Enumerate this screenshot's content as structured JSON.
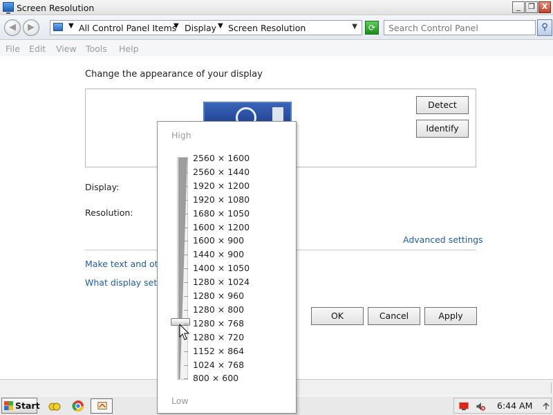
{
  "window": {
    "title": "Screen Resolution",
    "minimize": "_",
    "restore": "❐",
    "close": "X"
  },
  "navigation": {
    "back": "◀",
    "forward": "▶",
    "breadcrumbs": [
      "All Control Panel Items",
      "Display",
      "Screen Resolution"
    ],
    "search_placeholder": "Search Control Panel"
  },
  "menu": [
    "File",
    "Edit",
    "View",
    "Tools",
    "Help"
  ],
  "content": {
    "heading": "Change the appearance of your display",
    "detect_label": "Detect",
    "identify_label": "Identify",
    "display_label": "Display:",
    "resolution_label": "Resolution:",
    "advanced_link": "Advanced settings",
    "link_text_size": "Make text and oth",
    "link_display_settings": "What display setti",
    "ok_label": "OK",
    "cancel_label": "Cancel",
    "apply_label": "Apply"
  },
  "resolution_popup": {
    "high_label": "High",
    "low_label": "Low",
    "options": [
      "2560 × 1600",
      "2560 × 1440",
      "1920 × 1200",
      "1920 × 1080",
      "1680 × 1050",
      "1600 × 1200",
      "1600 × 900",
      "1440 × 900",
      "1400 × 1050",
      "1280 × 1024",
      "1280 × 960",
      "1280 × 800",
      "1280 × 768",
      "1280 × 720",
      "1152 × 864",
      "1024 × 768",
      "800 × 600"
    ],
    "selected": "1280 × 768"
  },
  "taskbar": {
    "start_label": "Start",
    "clock": "6:44 AM"
  },
  "icons": {
    "app": "display-settings-icon",
    "search": "magnifier-icon",
    "refresh": "refresh-icon"
  },
  "colors": {
    "link": "#1e5ba8",
    "close": "#c2412b"
  }
}
